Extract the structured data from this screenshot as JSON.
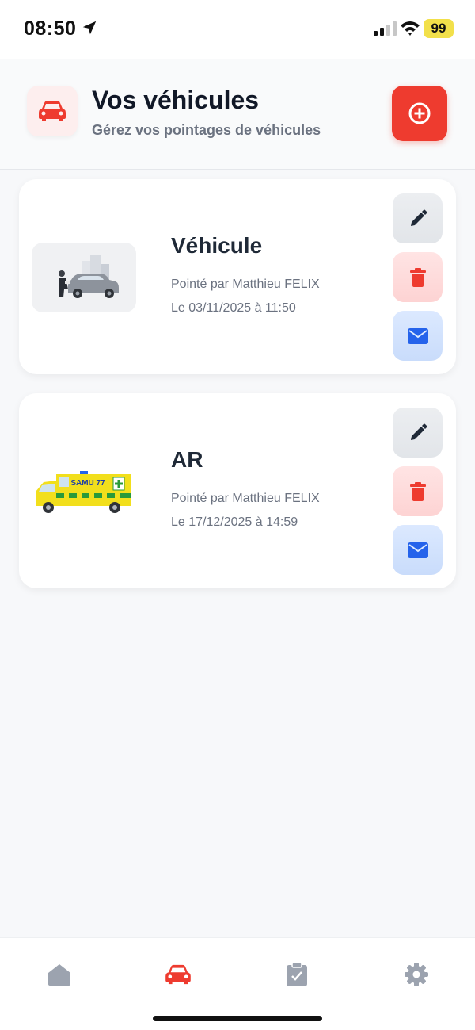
{
  "status_bar": {
    "time": "08:50",
    "battery": "99",
    "battery_color": "#f2e04a"
  },
  "header": {
    "title": "Vos véhicules",
    "subtitle": "Gérez vos pointages de véhicules",
    "icon": "car-icon",
    "add_button_icon": "plus-circle-icon"
  },
  "vehicles": [
    {
      "name": "Véhicule",
      "pointed_by": "Pointé par Matthieu FELIX",
      "date_line": "Le 03/11/2025 à 11:50",
      "thumbnail": "car-inspection-illustration"
    },
    {
      "name": "AR",
      "pointed_by": "Pointé par Matthieu FELIX",
      "date_line": "Le 17/12/2025 à 14:59",
      "thumbnail": "ambulance-illustration",
      "thumbnail_text": "SAMU 77"
    }
  ],
  "actions": {
    "edit_icon": "pencil-icon",
    "delete_icon": "trash-icon",
    "mail_icon": "envelope-icon"
  },
  "nav": [
    {
      "id": "home",
      "icon": "home-icon",
      "active": false
    },
    {
      "id": "vehicles",
      "icon": "car-icon",
      "active": true
    },
    {
      "id": "tasks",
      "icon": "clipboard-check-icon",
      "active": false
    },
    {
      "id": "settings",
      "icon": "gear-icon",
      "active": false
    }
  ],
  "colors": {
    "accent": "#ee3b2f",
    "inactive_icon": "#9ca3af",
    "edit_icon": "#1f2937",
    "delete_icon": "#ee3b2f",
    "mail_icon": "#2563eb"
  }
}
